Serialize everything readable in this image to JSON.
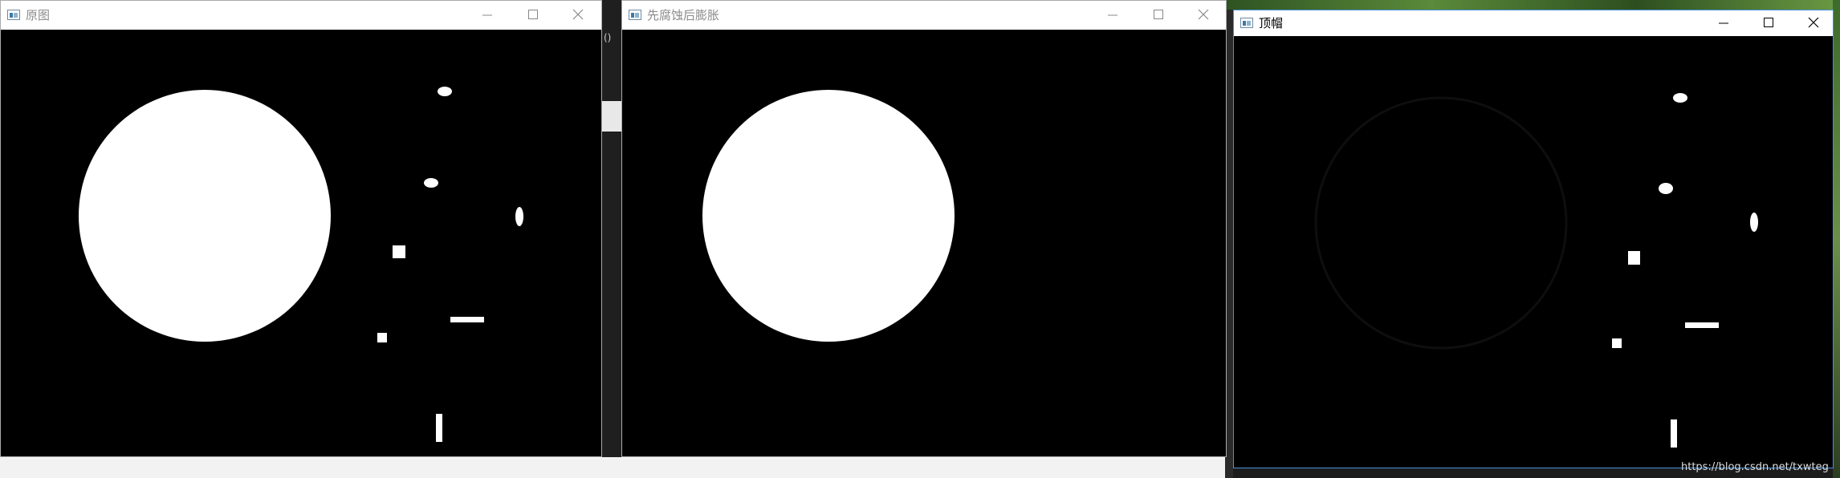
{
  "windows": [
    {
      "title": "原图",
      "state": "inactive"
    },
    {
      "title": "先腐蚀后膨胀",
      "state": "inactive"
    },
    {
      "title": "顶帽",
      "state": "active"
    }
  ],
  "background_fragments": {
    "between_first_and_second": "()",
    "watermark": "https://blog.csdn.net/txwteg"
  },
  "colors": {
    "canvas": "#000000",
    "shape": "#ffffff",
    "tophat_ring": "#0e0e0e",
    "desktop_green": "#3d6b2b"
  },
  "icons": [
    "app-icon",
    "minimize-icon",
    "maximize-icon",
    "close-icon"
  ]
}
